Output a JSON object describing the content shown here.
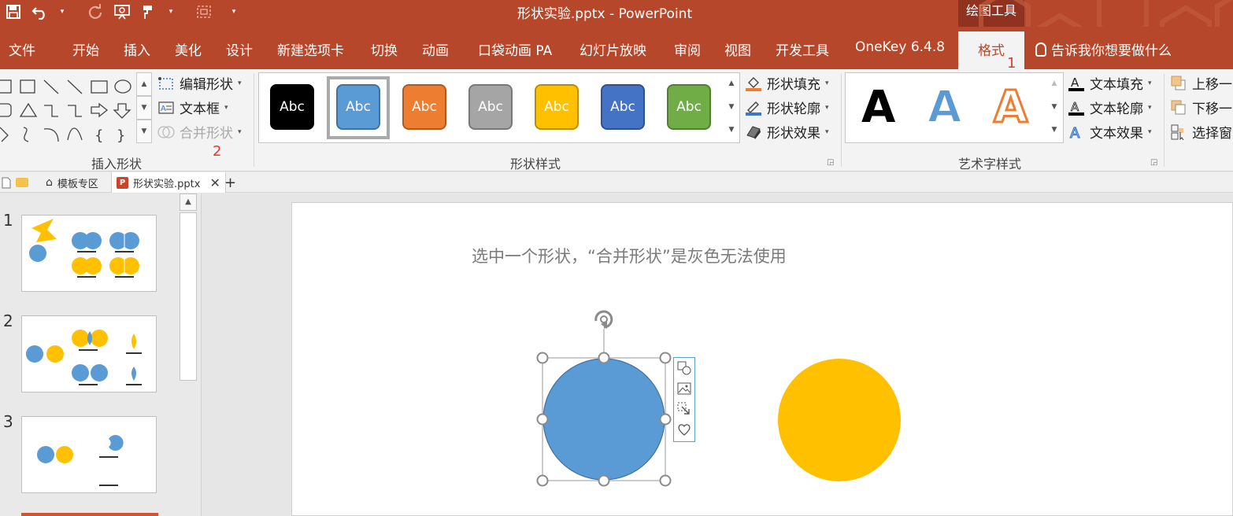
{
  "window": {
    "title": "形状实验.pptx - PowerPoint",
    "context_group": "绘图工具"
  },
  "qat": {
    "save_icon": "save-icon",
    "undo_icon": "undo-icon",
    "redo_icon": "redo-icon",
    "start_show_icon": "slideshow-icon",
    "format_painter_icon": "format-painter-icon",
    "select_icon": "select-area-icon",
    "customize_icon": "customize-caret-icon"
  },
  "tabs": [
    "文件",
    "开始",
    "插入",
    "美化",
    "设计",
    "新建选项卡",
    "切换",
    "动画",
    "口袋动画 PA",
    "幻灯片放映",
    "审阅",
    "视图",
    "开发工具",
    "OneKey 6.4.8"
  ],
  "active_tab": "格式",
  "tell_me": "告诉我你想要做什么",
  "annotations": {
    "one": "1",
    "two": "2"
  },
  "ribbon": {
    "insert_shapes": {
      "label": "插入形状",
      "edit_shape": "编辑形状",
      "textbox": "文本框",
      "merge_shapes": "合并形状"
    },
    "shape_styles": {
      "label": "形状样式",
      "preset_text": "Abc",
      "presets": [
        {
          "fill": "#000000",
          "border": "#000000"
        },
        {
          "fill": "#5b9bd5",
          "border": "#41719c"
        },
        {
          "fill": "#ed7d31",
          "border": "#ae5a21"
        },
        {
          "fill": "#a5a5a5",
          "border": "#787878"
        },
        {
          "fill": "#ffc000",
          "border": "#bc8c00"
        },
        {
          "fill": "#4472c4",
          "border": "#2f528f"
        },
        {
          "fill": "#70ad47",
          "border": "#507e32"
        }
      ],
      "fill": "形状填充",
      "outline": "形状轮廓",
      "effects": "形状效果"
    },
    "wordart": {
      "label": "艺术字样式",
      "sample": "A",
      "text_fill": "文本填充",
      "text_outline": "文本轮廓",
      "text_effects": "文本效果"
    },
    "arrange": {
      "bring_forward": "上移一",
      "send_backward": "下移一",
      "selection_pane": "选择窗"
    }
  },
  "doc_tabs": {
    "template_zone": "模板专区",
    "file_tab": "形状实验.pptx"
  },
  "thumbnails": [
    {
      "num": "1"
    },
    {
      "num": "2"
    },
    {
      "num": "3"
    }
  ],
  "slide": {
    "caption": "选中一个形状，“合并形状”是灰色无法使用",
    "blue_color": "#5b9bd5",
    "yellow_color": "#ffc000"
  }
}
